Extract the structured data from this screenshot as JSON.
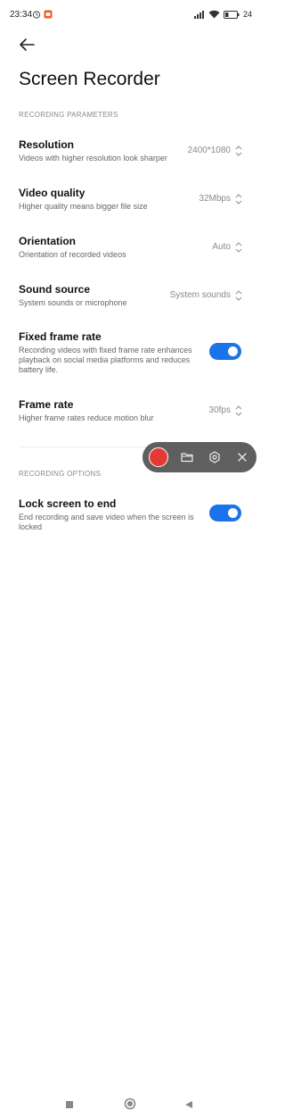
{
  "status": {
    "time": "23:34",
    "battery": "24"
  },
  "header": {
    "title": "Screen Recorder"
  },
  "sections": {
    "recording_parameters": "RECORDING PARAMETERS",
    "recording_options": "RECORDING OPTIONS"
  },
  "rows": [
    {
      "title": "Resolution",
      "subtitle": "Videos with higher resolution look sharper",
      "value": "2400*1080"
    },
    {
      "title": "Video quality",
      "subtitle": "Higher quality means bigger file size",
      "value": "32Mbps"
    },
    {
      "title": "Orientation",
      "subtitle": "Orientation of recorded videos",
      "value": "Auto"
    },
    {
      "title": "Sound source",
      "subtitle": "System sounds or microphone",
      "value": "System sounds"
    },
    {
      "title": "Fixed frame rate",
      "subtitle": "Recording videos with fixed frame rate enhances playback on social media platforms and reduces battery life.",
      "toggle_on": true
    },
    {
      "title": "Frame rate",
      "subtitle": "Higher frame rates reduce motion blur",
      "value": "30fps"
    },
    {
      "title": "Lock screen to end",
      "subtitle": "End recording and save video when the screen is locked",
      "toggle_on": true
    }
  ],
  "colors": {
    "accent": "#1a73e8",
    "record": "#e53935",
    "floating_bar": "#5f5f5f"
  },
  "icons": {
    "back": "arrow-left-icon",
    "folder": "folder-icon",
    "settings": "settings-icon",
    "close": "close-icon",
    "nav_recents": "square-icon",
    "nav_home": "circle-icon",
    "nav_back": "triangle-back-icon"
  }
}
